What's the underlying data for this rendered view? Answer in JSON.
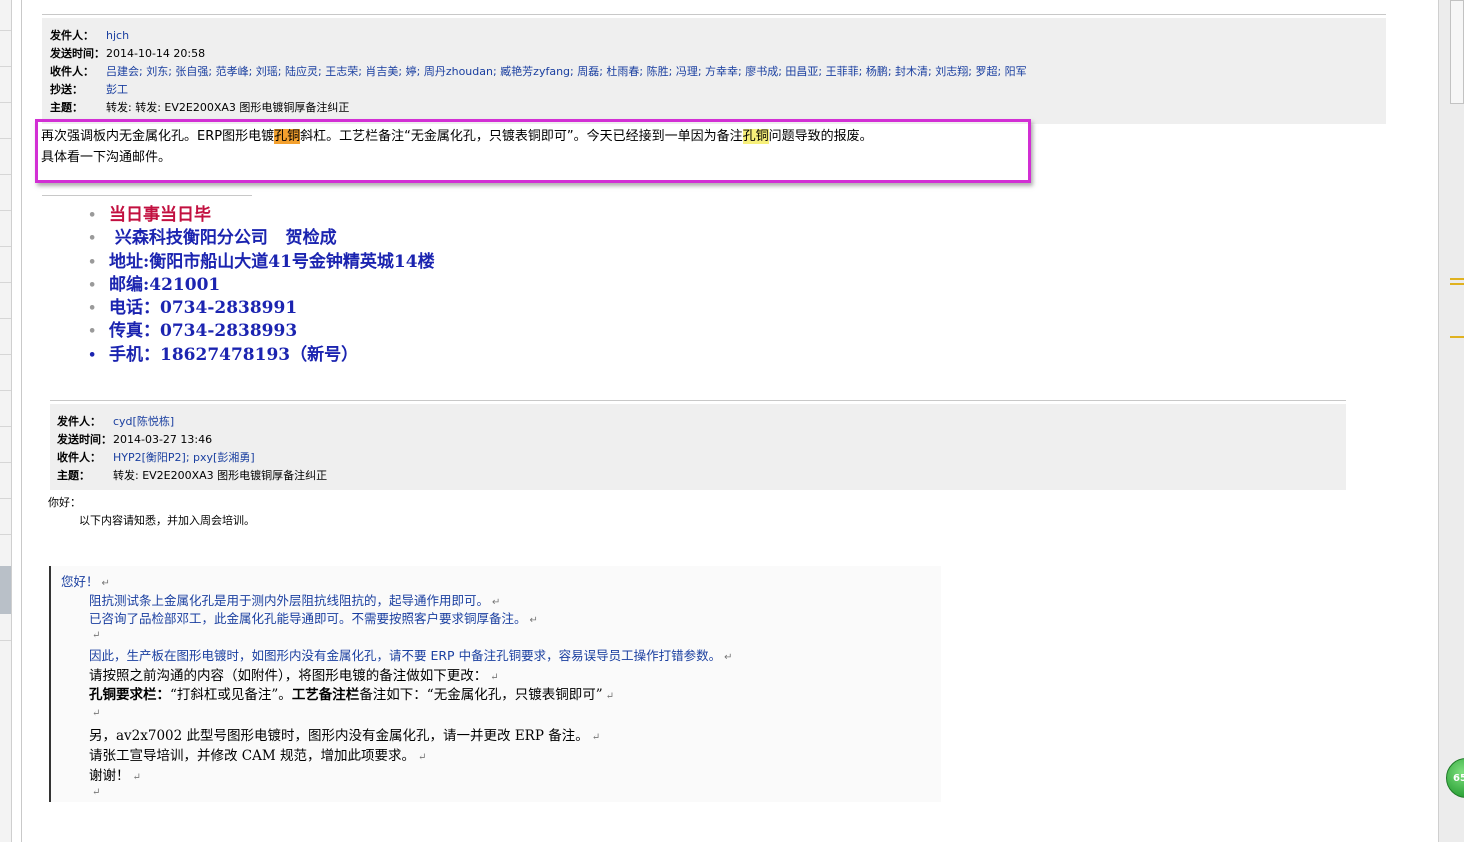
{
  "email1": {
    "from_label": "发件人：",
    "from": "hjch",
    "time_label": "发送时间：",
    "time": "2014-10-14 20:58",
    "to_label": "收件人：",
    "to": "吕建会; 刘东; 张自强; 范孝峰; 刘瑶; 陆应灵; 王志荣; 肖吉美; 婷; 周丹zhoudan; 臧艳芳zyfang; 周磊; 杜雨春; 陈胜; 冯理; 方幸幸; 廖书成; 田昌亚; 王菲菲; 杨鹏; 封木清; 刘志翔; 罗超; 阳军",
    "cc_label": "抄送：",
    "cc": "彭工",
    "subject_label": "主题：",
    "subject": "转发: 转发: EV2E200XA3 图形电镀铜厚备注纠正",
    "body_line1_a": "再次强调板内无金属化孔。ERP图形电镀",
    "body_line1_hl1": "孔铜",
    "body_line1_b": "斜杠。工艺栏备注“无金属化孔，只镀表铜即可”。今天已经接到一单因为备注",
    "body_line1_hl2": "孔铜",
    "body_line1_c": "问题导致的报废。",
    "body_line2": "具体看一下沟通邮件。"
  },
  "signature": [
    "当日事当日毕",
    " 兴森科技衡阳分公司   贺检成",
    "地址:衡阳市船山大道41号金钟精英城14楼",
    "邮编:421001",
    "电话：0734-2838991",
    "传真：0734-2838993",
    "手机：18627478193（新号）"
  ],
  "email2": {
    "from_label": "发件人：",
    "from": "cyd[陈悦栋]",
    "time_label": "发送时间：",
    "time": "2014-03-27 13:46",
    "to_label": "收件人：",
    "to": "HYP2[衡阳P2]; pxy[彭湘勇]",
    "subject_label": "主题：",
    "subject": "转发: EV2E200XA3 图形电镀铜厚备注纠正",
    "greeting": "你好：",
    "intro": "以下内容请知悉，并加入周会培训。"
  },
  "quoted": {
    "l1": "您好！",
    "l2": "阻抗测试条上金属化孔是用于测内外层阻抗线阻抗的，起导通作用即可。",
    "l3": "已咨询了品检部邓工，此金属化孔能导通即可。不需要按照客户要求铜厚备注。",
    "l4": "因此，生产板在图形电镀时，如图形内没有金属化孔，请不要 ERP 中备注孔铜要求，容易误导员工操作打错参数。",
    "l5": "请按照之前沟通的内容（如附件），将图形电镀的备注做如下更改：",
    "l6_bold1": "孔铜要求栏：",
    "l6_a": "“打斜杠或见备注”。",
    "l6_bold2": "工艺备注栏",
    "l6_b": "备注如下：“无金属化孔，只镀表铜即可”",
    "l7": "另，av2x7002 此型号图形电镀时，图形内没有金属化孔，请一并更改 ERP 备注。",
    "l8": "请张工宣导培训，并修改 CAM 规范，增加此项要求。",
    "l9": "谢谢！",
    "para_mark": "↵"
  },
  "badge": "65",
  "colors": {
    "annotation_box": "#d22fd4",
    "signature_blue": "#1b24b0",
    "signature_red": "#c21040",
    "link_blue": "#1a3fa0",
    "highlight_orange": "#f3a02e",
    "highlight_yellow": "#f6ef7a"
  }
}
